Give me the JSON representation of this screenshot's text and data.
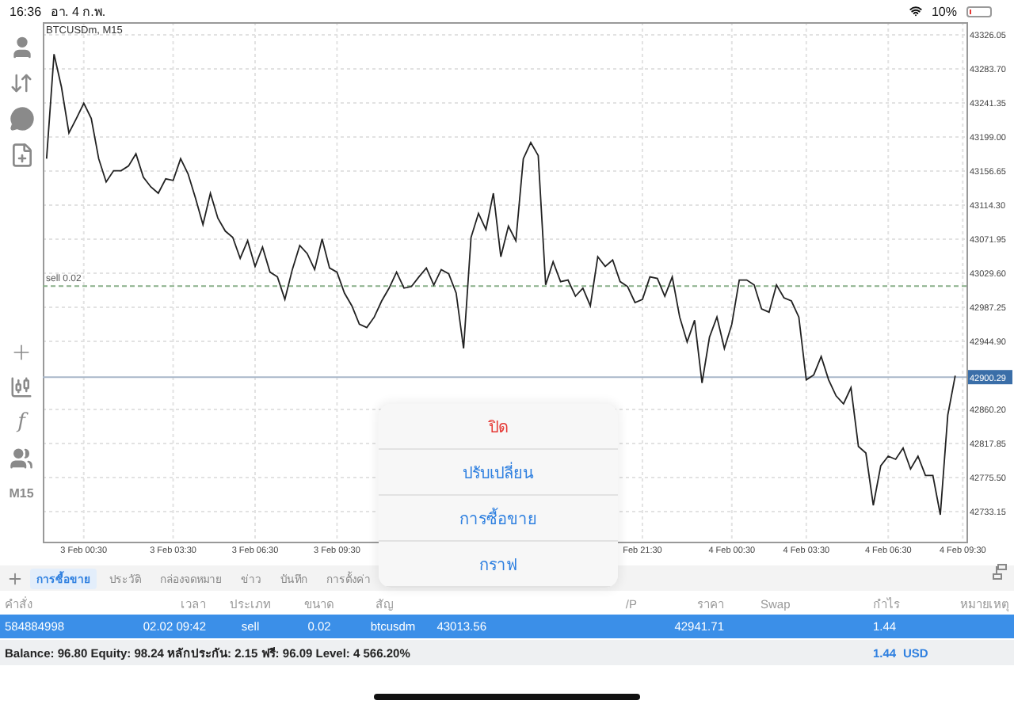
{
  "status_bar": {
    "time": "16:36",
    "date": "อา. 4 ก.พ.",
    "battery_percent": "10%"
  },
  "toolbar": {
    "indicator_glyph": "f",
    "timeframe": "M15"
  },
  "chart": {
    "chart_data": {
      "type": "line",
      "title": "BTCUSDm, M15",
      "ylim": [
        42695.6,
        43341.8
      ],
      "categories": [
        null,
        null,
        null,
        null,
        null,
        "3 Feb 00:30",
        null,
        null,
        null,
        null,
        null,
        null,
        null,
        null,
        null,
        null,
        null,
        "3 Feb 03:30",
        null,
        null,
        null,
        null,
        null,
        null,
        null,
        null,
        null,
        null,
        "3 Feb 06:30",
        null,
        null,
        null,
        null,
        null,
        null,
        null,
        null,
        null,
        null,
        "3 Feb 09:30",
        null,
        null,
        null,
        null,
        null,
        null,
        null,
        null,
        null,
        null,
        null,
        null,
        null,
        null,
        null,
        null,
        null,
        null,
        null,
        null,
        null,
        null,
        null,
        null,
        null,
        null,
        null,
        null,
        null,
        null,
        null,
        null,
        null,
        null,
        null,
        null,
        null,
        null,
        null,
        null,
        "Feb 21:30",
        null,
        null,
        null,
        null,
        null,
        null,
        null,
        null,
        null,
        null,
        null,
        "4 Feb 00:30",
        null,
        null,
        null,
        null,
        null,
        null,
        null,
        null,
        null,
        "4 Feb 03:30",
        null,
        null,
        null,
        null,
        null,
        null,
        null,
        null,
        null,
        null,
        "4 Feb 06:30",
        null,
        null,
        null,
        null,
        null,
        null,
        null,
        null,
        null,
        "4 Feb 09:30"
      ],
      "yticks": [
        {
          "value": 43326.05,
          "label": "43326.05"
        },
        {
          "value": 43283.7,
          "label": "43283.70"
        },
        {
          "value": 43241.35,
          "label": "43241.35"
        },
        {
          "value": 43199,
          "label": "43199.00"
        },
        {
          "value": 43156.65,
          "label": "43156.65"
        },
        {
          "value": 43114.3,
          "label": "43114.30"
        },
        {
          "value": 43071.95,
          "label": "43071.95"
        },
        {
          "value": 43029.6,
          "label": "43029.60"
        },
        {
          "value": 42987.25,
          "label": "42987.25"
        },
        {
          "value": 42944.9,
          "label": "42944.90"
        },
        {
          "value": 42860.2,
          "label": "42860.20"
        },
        {
          "value": 42817.85,
          "label": "42817.85"
        },
        {
          "value": 42775.5,
          "label": "42775.50"
        },
        {
          "value": 42733.15,
          "label": "42733.15"
        }
      ],
      "series": [
        {
          "color": "#222222",
          "values": [
            43172,
            43302,
            43261,
            43204,
            43222,
            43241,
            43222,
            43172,
            43143,
            43157,
            43157,
            43163,
            43178,
            43149,
            43137,
            43129,
            43147,
            43145,
            43172,
            43153,
            43123,
            43090,
            43129,
            43098,
            43082,
            43074,
            43048,
            43070,
            43038,
            43062,
            43031,
            43025,
            42997,
            43034,
            43064,
            43054,
            43034,
            43072,
            43036,
            43031,
            43005,
            42989,
            42966,
            42962,
            42975,
            42995,
            43011,
            43031,
            43011,
            43013,
            43025,
            43036,
            43015,
            43034,
            43029,
            43005,
            42936,
            43074,
            43104,
            43084,
            43129,
            43050,
            43088,
            43070,
            43172,
            43192,
            43176,
            43015,
            43044,
            43019,
            43021,
            43001,
            43011,
            42989,
            43050,
            43038,
            43046,
            43019,
            43013,
            42993,
            42997,
            43025,
            43023,
            43001,
            43025,
            42975,
            42944,
            42971,
            42893,
            42950,
            42975,
            42936,
            42966,
            43021,
            43021,
            43015,
            42985,
            42981,
            43015,
            42999,
            42995,
            42975,
            42897,
            42903,
            42926,
            42897,
            42877,
            42867,
            42887,
            42814,
            42806,
            42741,
            42790,
            42802,
            42798,
            42812,
            42786,
            42802,
            42778,
            42778,
            42729,
            42853,
            42902,
            null
          ]
        }
      ],
      "grid": true,
      "ref_lines": [
        {
          "axis": "y",
          "value": 43013.56,
          "label": "sell 0.02",
          "color": "#8bb08b"
        },
        {
          "axis": "y",
          "value": 42900.29,
          "label": "42900.29",
          "color": "#a9b7c9"
        }
      ]
    }
  },
  "tabs": [
    {
      "label": "การซื้อขาย",
      "selected": true
    },
    {
      "label": "ประวัติ",
      "selected": false
    },
    {
      "label": "กล่องจดหมาย",
      "selected": false
    },
    {
      "label": "ข่าว",
      "selected": false
    },
    {
      "label": "บันทึก",
      "selected": false
    },
    {
      "label": "การตั้งค่า",
      "selected": false
    }
  ],
  "table": {
    "header": {
      "order": "คำสั่ง",
      "time": "เวลา",
      "type": "ประเภท",
      "volume": "ขนาด",
      "symbol": "สัญ",
      "column_8": "/P",
      "price": "ราคา",
      "swap": "Swap",
      "profit": "กำไร",
      "comment": "หมายเหตุ"
    },
    "rows": [
      {
        "selected": true,
        "order": "584884998",
        "time": "02.02 09:42",
        "type": "sell",
        "volume": "0.02",
        "symbol": "btcusdm",
        "column_6": "43013.56",
        "price": "42941.71",
        "profit": "1.44"
      }
    ]
  },
  "summary": {
    "text": "Balance: 96.80 Equity: 98.24 หลักประกัน: 2.15 ฟรี: 96.09 Level: 4 566.20%",
    "profit": "1.44",
    "currency": "USD"
  },
  "action_menu": [
    {
      "label": "ปิด",
      "kind": "destructive"
    },
    {
      "label": "ปรับเปลี่ยน",
      "kind": "action"
    },
    {
      "label": "การซื้อขาย",
      "kind": "action"
    },
    {
      "label": "กราฟ",
      "kind": "action"
    }
  ]
}
